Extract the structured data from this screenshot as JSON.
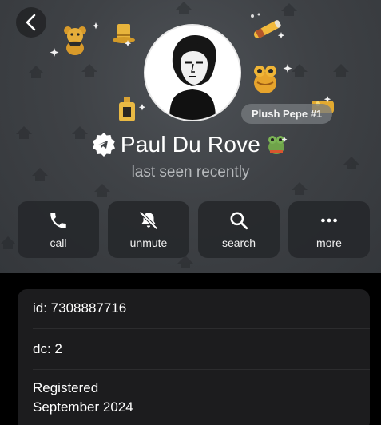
{
  "profile": {
    "name": "Paul Du Rove",
    "status": "last seen recently",
    "gift_label": "Plush Pepe #1"
  },
  "actions": [
    {
      "label": "call",
      "icon": "phone-icon"
    },
    {
      "label": "unmute",
      "icon": "bell-slash-icon"
    },
    {
      "label": "search",
      "icon": "search-icon"
    },
    {
      "label": "more",
      "icon": "more-dots-icon"
    }
  ],
  "info": {
    "id_text": "id: 7308887716",
    "dc_text": "dc: 2",
    "registered_label": "Registered",
    "registered_value": "September 2024"
  },
  "colors": {
    "header_bg": "#3f4246",
    "button_bg": "#26282b",
    "card_bg": "#1c1c1e",
    "status_text": "#b7babd",
    "gift_chip": "#787c80"
  }
}
